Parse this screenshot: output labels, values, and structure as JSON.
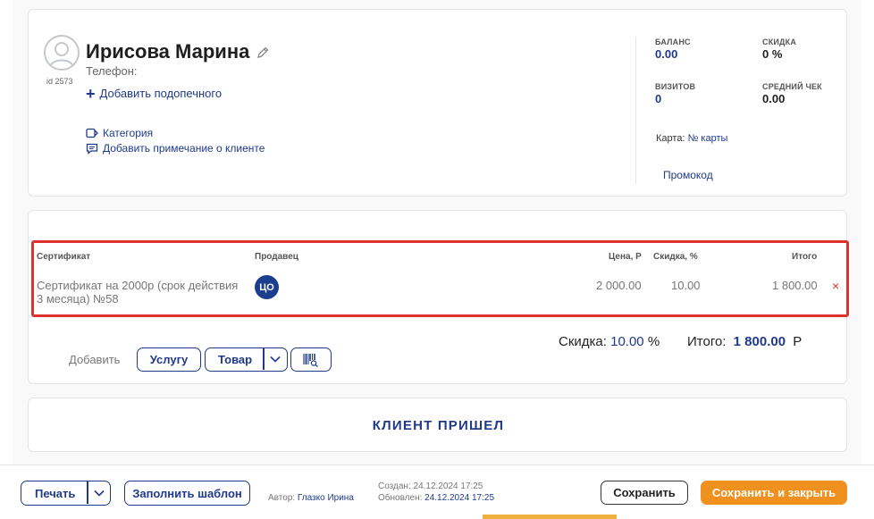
{
  "client": {
    "name": "Ирисова Марина",
    "id_label": "id 2573",
    "phone_label": "Телефон:",
    "add_ward": "Добавить подопечного",
    "category": "Категория",
    "add_note": "Добавить примечание о клиенте"
  },
  "stats": {
    "balance_label": "БАЛАНС",
    "balance_value": "0.00",
    "discount_label": "СКИДКА",
    "discount_value": "0 %",
    "visits_label": "ВИЗИТОВ",
    "visits_value": "0",
    "avg_check_label": "СРЕДНИЙ ЧЕК",
    "avg_check_value": "0.00",
    "card_label": "Карта:",
    "card_value": "№ карты",
    "promo": "Промокод"
  },
  "items": {
    "headers": {
      "certificate": "Сертификат",
      "seller": "Продавец",
      "price": "Цена, Р",
      "discount": "Скидка, %",
      "total": "Итого"
    },
    "rows": [
      {
        "name_line1": "Сертификат на 2000р (срок действия",
        "name_line2": "3 месяца) №58",
        "seller_initials": "ЦО",
        "price": "2 000.00",
        "discount": "10.00",
        "total": "1 800.00",
        "remove": "×"
      }
    ]
  },
  "add_bar": {
    "label": "Добавить",
    "service": "Услугу",
    "product": "Товар"
  },
  "totals": {
    "discount_label": "Скидка:",
    "discount_value": "10.00",
    "discount_unit": "%",
    "total_label": "Итого:",
    "total_value": "1 800.00",
    "currency": "Р"
  },
  "client_arrived": "КЛИЕНТ ПРИШЕЛ",
  "footer": {
    "print": "Печать",
    "fill_template": "Заполнить шаблон",
    "author_label": "Автор:",
    "author": "Глазко Ирина",
    "created_label": "Создан:",
    "created": "24.12.2024 17:25",
    "updated_label": "Обновлен:",
    "updated": "24.12.2024 17:25",
    "save": "Сохранить",
    "save_close": "Сохранить и закрыть"
  },
  "colors": {
    "accent": "#1f3a8a",
    "highlight": "#e0312c",
    "orange": "#f0901e"
  }
}
